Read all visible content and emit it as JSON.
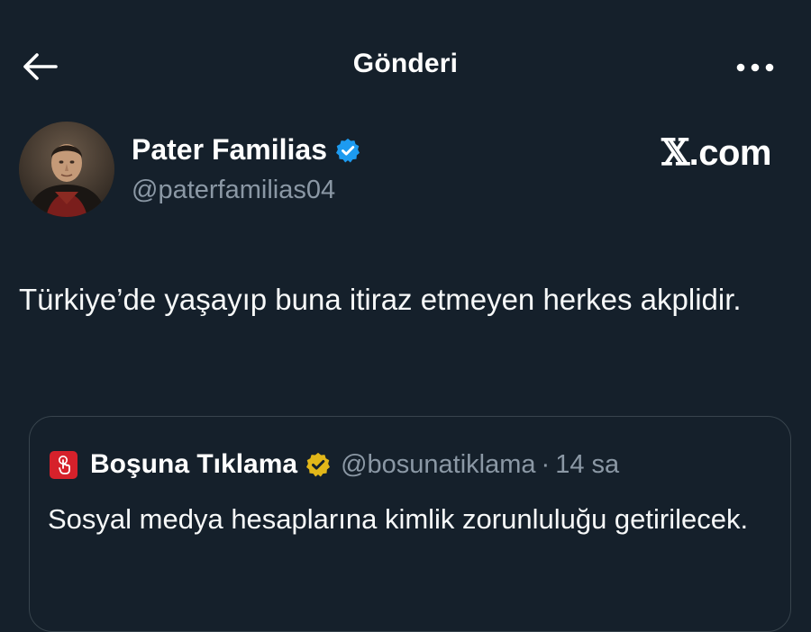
{
  "header": {
    "title": "Gönderi",
    "back_icon": "arrow-left-icon",
    "more_icon": "more-horizontal-icon"
  },
  "post": {
    "author_name": "Pater Familias",
    "author_handle": "@paterfamilias04",
    "verified": true,
    "verified_color": "#1d9bf0",
    "brand": ".com",
    "brand_mark": "𝕏",
    "text": "Türkiye’de yaşayıp buna itiraz etmeyen herkes akplidir."
  },
  "quoted_post": {
    "author_name": "Boşuna Tıklama",
    "author_handle": "@bosunatiklama",
    "separator": "·",
    "time": "14 sa",
    "badge_color": "#e2b719",
    "avatar_color": "#d6212b",
    "text": "Sosyal medya hesaplarına kimlik zorunluluğu getirilecek."
  }
}
